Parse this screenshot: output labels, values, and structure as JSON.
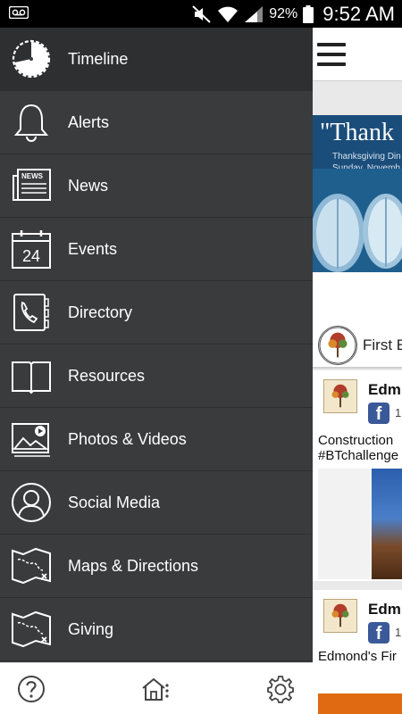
{
  "status_bar": {
    "battery_percent": "92%",
    "time": "9:52 AM",
    "icons": [
      "voicemail-icon",
      "mute-icon",
      "wifi-icon",
      "signal-icon",
      "battery-icon"
    ]
  },
  "drawer": {
    "items": [
      {
        "label": "Timeline",
        "icon": "timeline-icon",
        "active": true
      },
      {
        "label": "Alerts",
        "icon": "bell-icon"
      },
      {
        "label": "News",
        "icon": "newspaper-icon"
      },
      {
        "label": "Events",
        "icon": "calendar-icon"
      },
      {
        "label": "Directory",
        "icon": "phonebook-icon"
      },
      {
        "label": "Resources",
        "icon": "book-icon"
      },
      {
        "label": "Photos & Videos",
        "icon": "photos-videos-icon"
      },
      {
        "label": "Social Media",
        "icon": "person-icon"
      },
      {
        "label": "Maps & Directions",
        "icon": "map-icon"
      },
      {
        "label": "Giving",
        "icon": "map-icon"
      }
    ],
    "news_icon_text": "NEWS",
    "calendar_day": "24",
    "bottom_bar": [
      "help-icon",
      "home-icon",
      "settings-icon"
    ]
  },
  "content": {
    "banner": {
      "title": "\"Thank",
      "subtitle_line1": "Thanksgiving Din",
      "subtitle_line2": "Sunday, Novemb"
    },
    "church_name": "First E",
    "posts": [
      {
        "author": "Edm",
        "fb_count": "1",
        "text_line1": "Construction",
        "text_line2": "#BTchallenge"
      },
      {
        "author": "Edm",
        "fb_count": "1",
        "text_line1": "Edmond's Fir"
      }
    ]
  }
}
